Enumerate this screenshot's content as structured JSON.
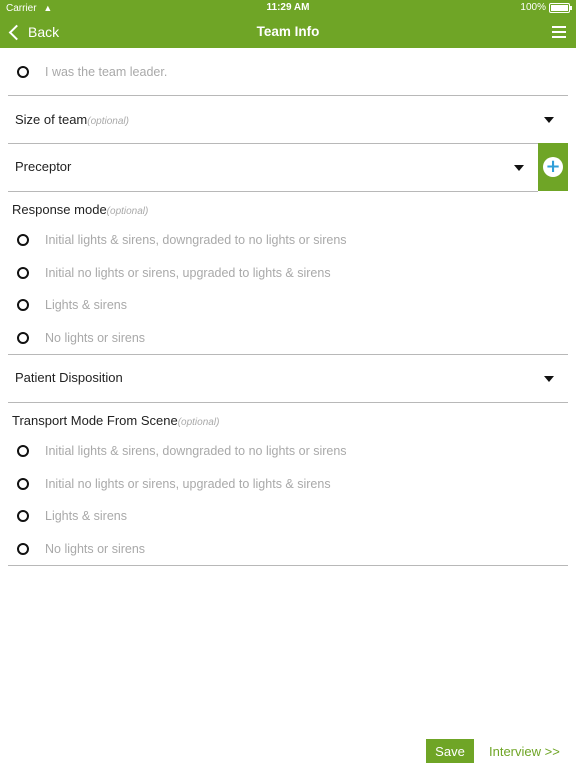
{
  "status": {
    "carrier": "Carrier",
    "time": "11:29 AM",
    "battery": "100%"
  },
  "nav": {
    "back": "Back",
    "title": "Team Info"
  },
  "team_leader": {
    "label": "I was the team leader."
  },
  "size_of_team": {
    "label": "Size of team",
    "optional": "(optional)"
  },
  "preceptor": {
    "label": "Preceptor",
    "add_symbol": "+"
  },
  "response_mode": {
    "title": "Response mode",
    "optional": "(optional)",
    "options": [
      "Initial lights & sirens, downgraded to no lights or sirens",
      "Initial no lights or sirens, upgraded to lights & sirens",
      "Lights & sirens",
      "No lights or sirens"
    ]
  },
  "patient_disposition": {
    "label": "Patient Disposition"
  },
  "transport_mode": {
    "title": "Transport Mode From Scene",
    "optional": "(optional)",
    "options": [
      "Initial lights & sirens, downgraded to no lights or sirens",
      "Initial no lights or sirens, upgraded to lights & sirens",
      "Lights & sirens",
      "No lights or sirens"
    ]
  },
  "footer": {
    "save": "Save",
    "interview": "Interview >>"
  },
  "colors": {
    "brand_green": "#6fa526",
    "add_icon_blue": "#2f9ed8",
    "muted_text": "#a9a9a9"
  }
}
